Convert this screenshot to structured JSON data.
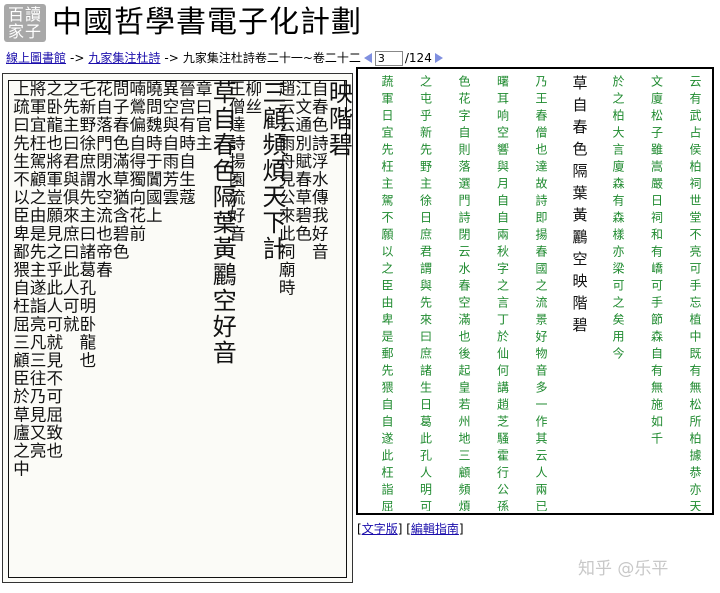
{
  "header": {
    "logo_line1": "百讀",
    "logo_line2": "家子",
    "title": "中國哲學書電子化計劃"
  },
  "breadcrumb": {
    "home": "線上圖書館",
    "sep": "->",
    "book": "九家集注杜詩",
    "chapter": "九家集注杜詩卷二十一~卷二十二",
    "page_value": "3",
    "page_total": "/124"
  },
  "scan_columns": [
    "上疏曰先生不以臣卑鄙猥自枉屈三顧臣於草廬之中",
    "將軍宜枉駕顧之由是先主遂詣亮凡三往乃見又亮",
    "之卧龍也將軍豈願見之乎此人可就見不可屈致也",
    "之先主曰君與俱來庶曰此人可就",
    "乇新野徐庶謂先主曰諸葛孔明卧龍也",
    "花自落門閉水空流也帝春",
    "問子春色滿草猶含碧色",
    "喃鶯偏自得獨向花前",
    "曉問魏時于闐國上",
    "異空與自雨芳雲",
    "晉宫有時自生蔻",
    "章曰官主",
    "草自春色隔葉黃鸝空好音",
    "王僧達詩揚園流好音",
    "柳丝",
    "三顧頻煩天下計",
    "趙云云雨舟見公來此祠廟時",
    "江文通別賦春草碧色",
    "自春色詩浮水傳我好音",
    "映階碧"
  ],
  "text_columns": [
    {
      "text": "云有武占侯柏祠世堂不亮在",
      "color": "green"
    },
    {
      "text": "文廈松子柏大言廈雖嵩森有森",
      "color": "green"
    },
    {
      "text": "於之柏大言廈森有森樣亦梁亦",
      "color": "green"
    },
    {
      "text": "草自春色隔葉黃鸝空好音",
      "color": "black"
    },
    {
      "text": "乃王春僧也達故詩即揚春國",
      "color": "green"
    },
    {
      "text": "曙耳响空響與月自自兩秋字",
      "color": "green"
    },
    {
      "text": "色花字自則落選門詩閉云水",
      "color": "green"
    },
    {
      "text": "之屯乎新先野主徐日庶君謂",
      "color": "green"
    },
    {
      "text": "蔬軍日宜先枉主駕不願以之",
      "color": "green"
    }
  ],
  "right_columns": [
    {
      "text": "云有武占侯柏祠世堂不亮可手忘植中既有無松所柏據恭亦天末長必豈然亦若手要是州植絶乎句",
      "color": "green"
    },
    {
      "text": "文廈松子雖嵩嚴日祠和有嶠可手節森自有無施如千",
      "color": "green"
    },
    {
      "text": "於之柏大言廈森有森樣亦梁可之矣用今",
      "color": "green"
    },
    {
      "text": "草自春色隔葉黃鸝空映階碧",
      "color": "black"
    },
    {
      "text": "乃王春僧也達故詩即揚春國之流景好物音多一作其云人兩已句色江詩文洋通水別懷賦我春好草音碧",
      "color": "green"
    },
    {
      "text": "曙耳响空響與月自自兩秋字之言丁於仙何講趙芝騷霍行公孫忘見主氏而公舊陸物來宅詩空此云山自屹春廟時",
      "color": "green"
    },
    {
      "text": "色花字自則落選門詩閉云水春空滿也後起皇若州地三顧頻煩天下計",
      "color": "green"
    },
    {
      "text": "之屯乎新先野主徐日庶君謂與先來曰庶諸生日葛此孔人明可就見",
      "color": "green"
    },
    {
      "text": "蔬軍日宜先枉主駕不願以之臣由卑是郵先猥自自遂此枉詣屈三凡顧三子往草乃廬見之中又亮上",
      "color": "green"
    }
  ],
  "footer": {
    "text_version": "文字版",
    "edit_guide": "編輯指南",
    "watermark": "知乎 @乐平"
  }
}
